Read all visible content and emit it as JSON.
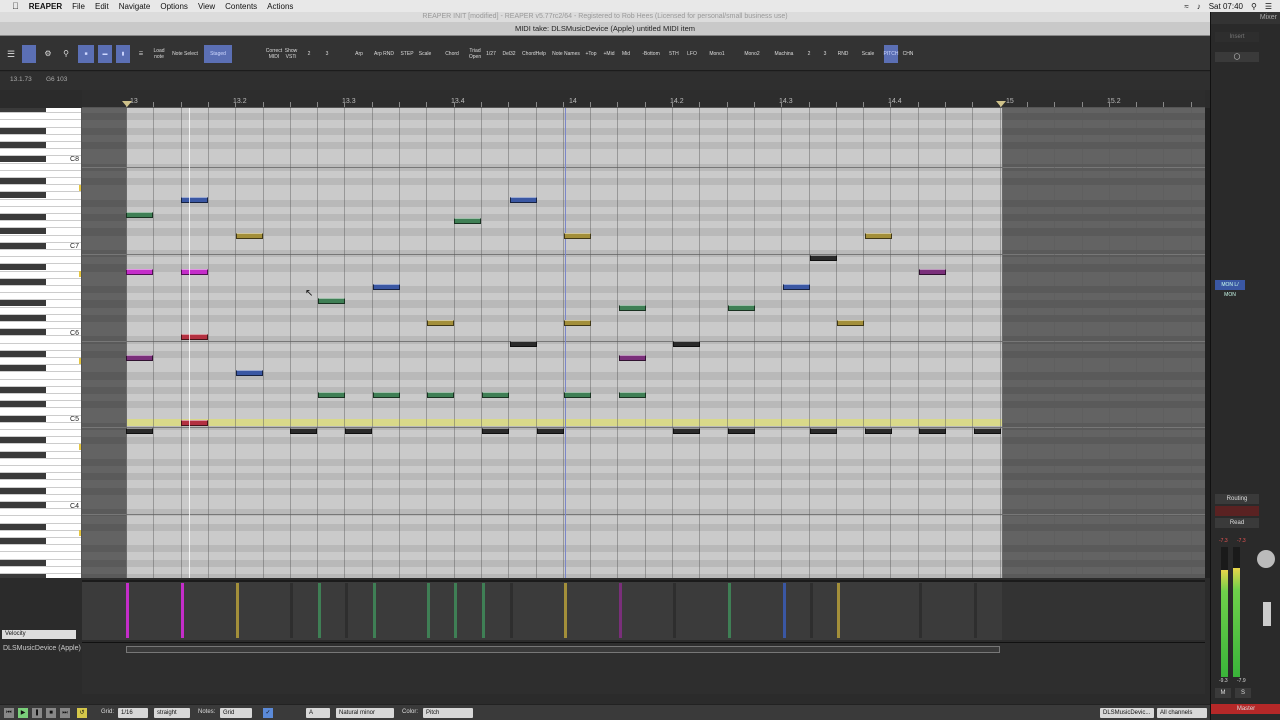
{
  "menubar": {
    "app": "REAPER",
    "items": [
      "File",
      "Edit",
      "Navigate",
      "Options",
      "View",
      "Contents",
      "Actions"
    ],
    "clock": "Sat 07:40"
  },
  "window_title": "REAPER INIT [modified] - REAPER v5.77rc2/64 - Registered to Rob Hees (Licensed for personal/small business use)",
  "midi_title": "MIDI take: DLSMusicDevice (Apple) untitled MIDI item",
  "toolbar": {
    "buttons": [
      {
        "label": "Note Select"
      },
      {
        "label": "Staged",
        "active": true
      },
      {
        "label": "Correct MIDI"
      },
      {
        "label": "Show VSTi"
      },
      {
        "label": "2"
      },
      {
        "label": "3"
      },
      {
        "label": "Arp"
      },
      {
        "label": "Arp RND"
      },
      {
        "label": "STEP"
      },
      {
        "label": "Scale"
      },
      {
        "label": "Chord"
      },
      {
        "label": "Triad Open"
      },
      {
        "label": "1/27"
      },
      {
        "label": "Del32"
      },
      {
        "label": "ChordHelp"
      },
      {
        "label": "Note Names"
      },
      {
        "label": "+Top"
      },
      {
        "label": "+Mid"
      },
      {
        "label": "Mid"
      },
      {
        "label": "-Bottom"
      },
      {
        "label": "5TH"
      },
      {
        "label": "LFO"
      },
      {
        "label": "Mono1"
      },
      {
        "label": "Mono2"
      },
      {
        "label": "Machina"
      },
      {
        "label": "2"
      },
      {
        "label": "3"
      },
      {
        "label": "RND"
      },
      {
        "label": "Scale"
      },
      {
        "label": "PITCH",
        "active": true
      },
      {
        "label": "CHN"
      }
    ]
  },
  "info": {
    "position": "13.1.73",
    "note": "G6 103"
  },
  "ruler": {
    "marks": [
      "13",
      "13.2",
      "13.3",
      "13.4",
      "14",
      "14.2",
      "14.3",
      "14.4",
      "15",
      "15.2"
    ]
  },
  "piano": {
    "octaves": [
      "C8",
      "C7",
      "C6",
      "C5",
      "C4"
    ]
  },
  "velocity_lane": {
    "label": "Velocity"
  },
  "track": {
    "name": "DLSMusicDevice (Apple)"
  },
  "bottom": {
    "grid_label": "Grid:",
    "grid_value": "1/16",
    "grid_type": "straight",
    "notes_label": "Notes:",
    "notes_value": "Grid",
    "key": "A",
    "scale": "Natural minor",
    "color_label": "Color:",
    "color_value": "Pitch",
    "channel_device": "DLSMusicDevic...",
    "channels": "All channels"
  },
  "mixer": {
    "title": "Mixer",
    "insert": "Insert",
    "routing": "Routing",
    "read": "Read",
    "mon": "MON L/ MON",
    "peak_l": "-7.3",
    "peak_r": "-7.3",
    "rms_l": "-9.3",
    "rms_r": "-7.9",
    "master": "Master",
    "m": "M",
    "s": "S"
  },
  "colors": {
    "green": "#3f7f55",
    "blue": "#3a57a3",
    "olive": "#a38f3a",
    "magenta": "#c42dc9",
    "purple": "#7a2f7a",
    "red": "#b33040",
    "dark": "#2a2a2a"
  }
}
